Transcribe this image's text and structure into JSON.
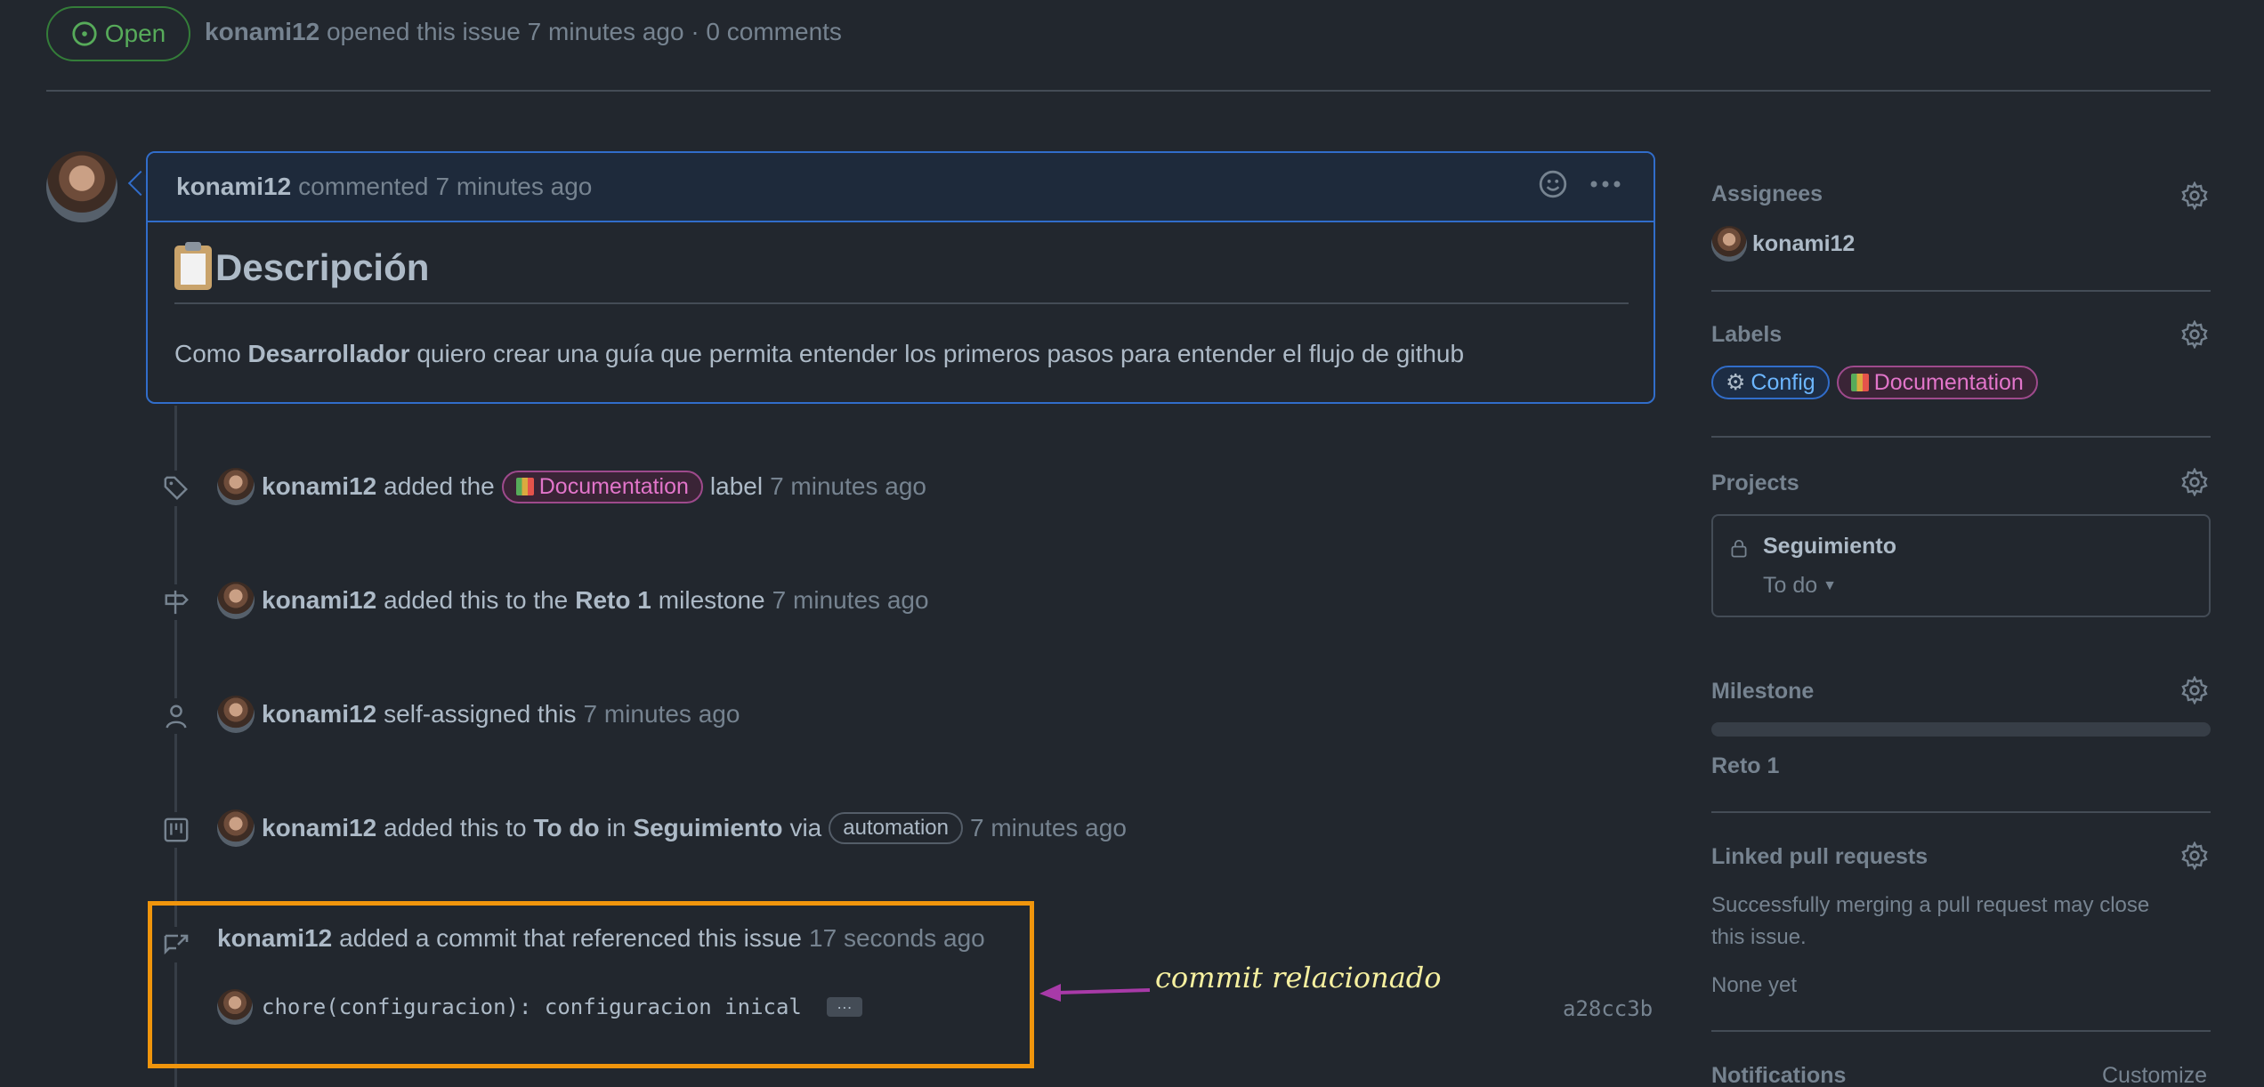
{
  "issue_header": {
    "state": "Open",
    "author": "konami12",
    "meta": "opened this issue 7 minutes ago · 0 comments"
  },
  "comment": {
    "author": "konami12",
    "action": "commented",
    "time": "7 minutes ago",
    "title": "Descripción",
    "body_pre": "Como ",
    "body_bold": "Desarrollador",
    "body_post": " quiero crear una guía que permita entender los primeros pasos para entender el flujo de github"
  },
  "timeline": {
    "label_event": {
      "user": "konami12",
      "pre": "added the",
      "label": "Documentation",
      "post": "label",
      "time": "7 minutes ago"
    },
    "milestone_event": {
      "user": "konami12",
      "pre": "added this to the",
      "milestone": "Reto 1",
      "post": "milestone",
      "time": "7 minutes ago"
    },
    "assign_event": {
      "user": "konami12",
      "text": "self-assigned this",
      "time": "7 minutes ago"
    },
    "project_event": {
      "user": "konami12",
      "pre": "added this to",
      "column": "To do",
      "mid": "in",
      "project": "Seguimiento",
      "via": "via",
      "badge": "automation",
      "time": "7 minutes ago"
    },
    "commit_event": {
      "user": "konami12",
      "text": "added a commit that referenced this issue",
      "time": "17 seconds ago",
      "message": "chore(configuracion): configuracion inical",
      "ellipsis": "…",
      "sha": "a28cc3b"
    }
  },
  "annotation": "commit relacionado",
  "sidebar": {
    "assignees": {
      "title": "Assignees",
      "user": "konami12"
    },
    "labels": {
      "title": "Labels",
      "items": [
        "Config",
        "Documentation"
      ]
    },
    "projects": {
      "title": "Projects",
      "name": "Seguimiento",
      "status": "To do"
    },
    "milestone": {
      "title": "Milestone",
      "name": "Reto 1",
      "progress": 0
    },
    "linked_prs": {
      "title": "Linked pull requests",
      "description_1": "Successfully merging a pull request may close",
      "description_2": "this issue.",
      "empty": "None yet"
    },
    "notifications": {
      "title": "Notifications",
      "action": "Customize"
    }
  },
  "colors": {
    "background": "#22272e",
    "accent": "#316dca",
    "open": "#57ab5a",
    "highlight": "#f0950c",
    "doc_label": "#e275ca",
    "config_label": "#6cb6ff"
  }
}
